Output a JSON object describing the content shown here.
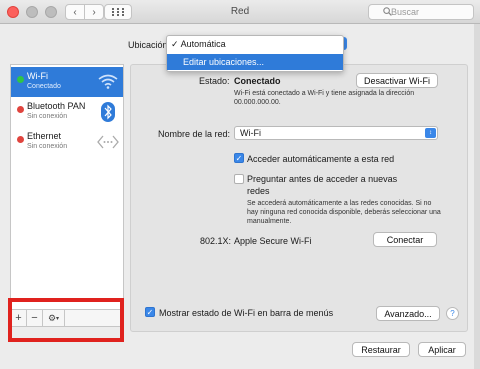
{
  "window": {
    "title": "Red"
  },
  "search": {
    "placeholder": "Buscar"
  },
  "location": {
    "label": "Ubicación:",
    "menu_items": [
      {
        "label": "Automática",
        "checked": true
      },
      {
        "label": "Editar ubicaciones...",
        "highlighted": true
      }
    ]
  },
  "services": [
    {
      "name": "Wi-Fi",
      "status": "Conectado",
      "dot_color": "#2fc548",
      "icon": "wifi-icon",
      "selected": true
    },
    {
      "name": "Bluetooth PAN",
      "status": "Sin conexión",
      "dot_color": "#e0443e",
      "icon": "bluetooth-icon",
      "selected": false
    },
    {
      "name": "Ethernet",
      "status": "Sin conexión",
      "dot_color": "#e0443e",
      "icon": "ethernet-icon",
      "selected": false
    }
  ],
  "toolbar": {
    "add": "+",
    "remove": "−",
    "gear": "⚙"
  },
  "main": {
    "status_label": "Estado:",
    "status_value": "Conectado",
    "disable_button": "Desactivar Wi-Fi",
    "status_detail": "Wi-Fi está conectado a Wi-Fi y tiene asignada la dirección 00.000.000.00.",
    "network_label": "Nombre de la red:",
    "network_value": "Wi-Fi",
    "auto_join_label": "Acceder automáticamente a esta red",
    "ask_label_1": "Preguntar antes de acceder a nuevas",
    "ask_label_2": "redes",
    "ask_detail": "Se accederá automáticamente a las redes conocidas. Si no hay ninguna red conocida disponible, deberás seleccionar una manualmente.",
    "x8021_label": "802.1X:",
    "x8021_value": "Apple Secure Wi-Fi",
    "connect_button": "Conectar",
    "show_status_label": "Mostrar estado de Wi-Fi en barra de menús",
    "advanced_button": "Avanzado...",
    "help": "?"
  },
  "footer": {
    "revert_button": "Restaurar",
    "apply_button": "Aplicar"
  },
  "colors": {
    "accent": "#3a87e8",
    "highlight": "#e0221e"
  }
}
